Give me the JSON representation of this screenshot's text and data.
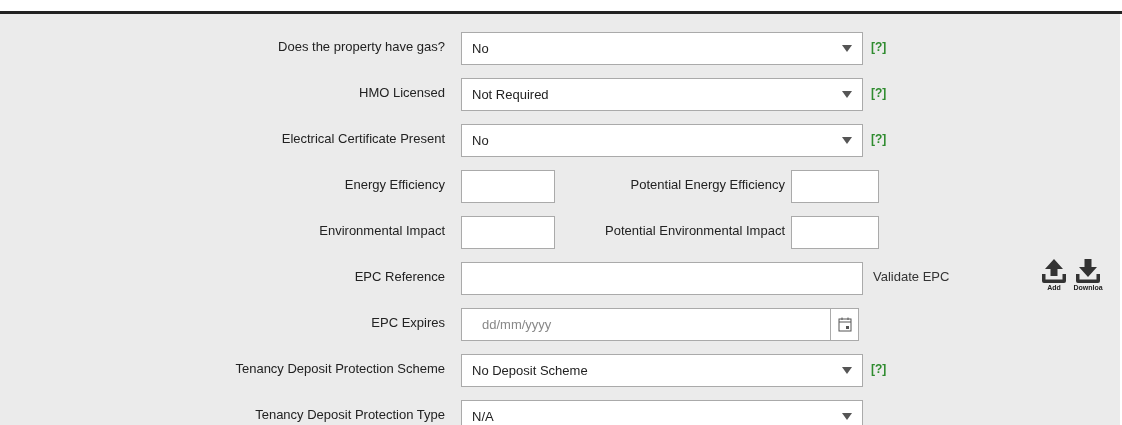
{
  "rows": [
    {
      "kind": "select",
      "label": "Does the property have gas?",
      "value": "No",
      "help": "[?]"
    },
    {
      "kind": "select",
      "label": "HMO Licensed",
      "value": "Not Required",
      "help": "[?]"
    },
    {
      "kind": "select",
      "label": "Electrical Certificate Present",
      "value": "No",
      "help": "[?]"
    },
    {
      "kind": "pair",
      "label": "Energy Efficiency",
      "label2": "Potential Energy Efficiency"
    },
    {
      "kind": "pair",
      "label": "Environmental Impact",
      "label2": "Potential Environmental Impact"
    },
    {
      "kind": "text",
      "label": "EPC Reference",
      "link": "Validate EPC",
      "actions": [
        "Add",
        "Downloa"
      ]
    },
    {
      "kind": "date",
      "label": "EPC Expires",
      "placeholder": "dd/mm/yyyy"
    },
    {
      "kind": "select",
      "label": "Tenancy Deposit Protection Scheme",
      "value": "No Deposit Scheme",
      "help": "[?]"
    },
    {
      "kind": "select",
      "label": "Tenancy Deposit Protection Type",
      "value": "N/A"
    }
  ]
}
